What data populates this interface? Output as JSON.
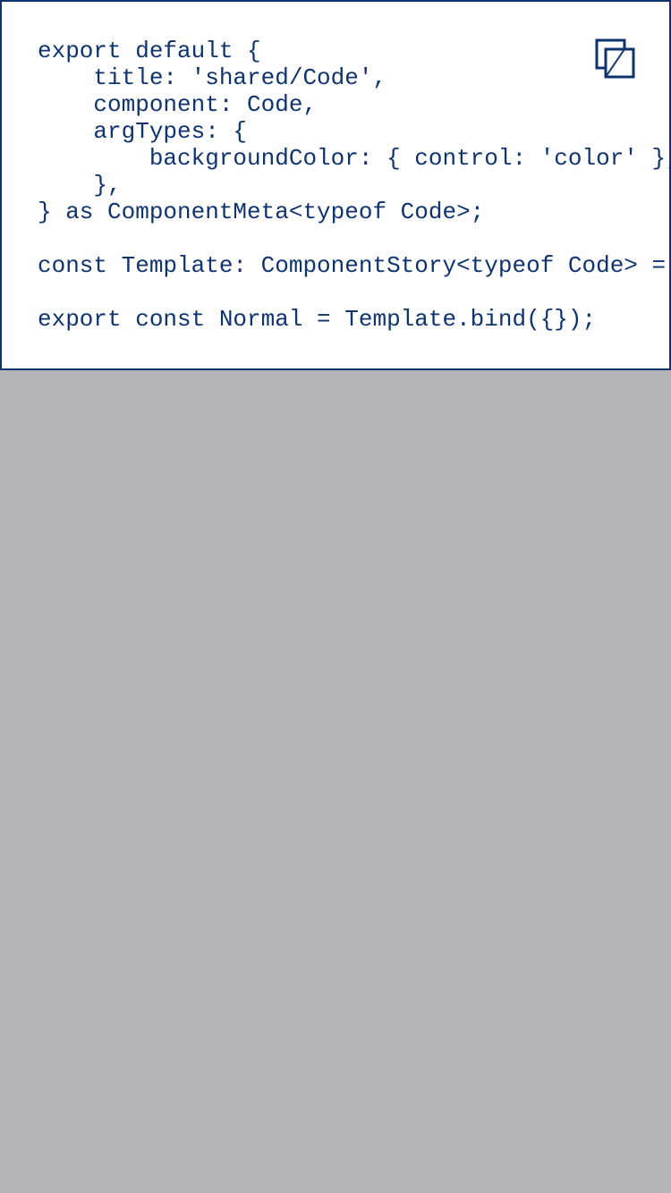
{
  "colors": {
    "page_background": "#b5b4b9",
    "panel_background": "#ffffff",
    "accent": "#0f336f"
  },
  "code": {
    "lines": [
      "export default {",
      "    title: 'shared/Code',",
      "    component: Code,",
      "    argTypes: {",
      "        backgroundColor: { control: 'color' },",
      "    },",
      "} as ComponentMeta<typeof Code>;",
      "",
      "const Template: ComponentStory<typeof Code> = (args) => <Code {...args} />;",
      "",
      "export const Normal = Template.bind({});"
    ]
  },
  "copy_button": {
    "icon": "copy-icon"
  }
}
